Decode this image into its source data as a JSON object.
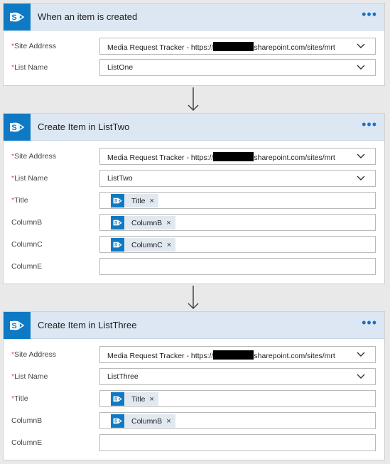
{
  "card1": {
    "title": "When an item is created",
    "more": "•••",
    "site_label": "Site Address",
    "site_value_prefix": "Media Request Tracker - https://",
    "site_value_suffix": "sharepoint.com/sites/mrt",
    "list_label": "List Name",
    "list_value": "ListOne"
  },
  "card2": {
    "title": "Create Item in ListTwo",
    "more": "•••",
    "site_label": "Site Address",
    "site_value_prefix": "Media Request Tracker - https://",
    "site_value_suffix": "sharepoint.com/sites/mrt",
    "list_label": "List Name",
    "list_value": "ListTwo",
    "title_label": "Title",
    "title_token": "Title",
    "colb_label": "ColumnB",
    "colb_token": "ColumnB",
    "colc_label": "ColumnC",
    "colc_token": "ColumnC",
    "cole_label": "ColumnE",
    "cole_value": ""
  },
  "card3": {
    "title": "Create Item in ListThree",
    "more": "•••",
    "site_label": "Site Address",
    "site_value_prefix": "Media Request Tracker - https://",
    "site_value_suffix": "sharepoint.com/sites/mrt",
    "list_label": "List Name",
    "list_value": "ListThree",
    "title_label": "Title",
    "title_token": "Title",
    "colb_label": "ColumnB",
    "colb_token": "ColumnB",
    "cole_label": "ColumnE",
    "cole_value": ""
  },
  "common": {
    "required_mark": "*",
    "remove_mark": "×",
    "sp_letter": "S"
  },
  "colors": {
    "accent": "#0f7ac4",
    "header_bg": "#dde7f3",
    "required": "#d9534f",
    "link": "#1a73c8"
  },
  "icons": {
    "sharepoint": "sharepoint-icon",
    "dropdown": "chevron-down-icon",
    "more": "more-options-icon",
    "arrow": "arrow-down-icon"
  }
}
